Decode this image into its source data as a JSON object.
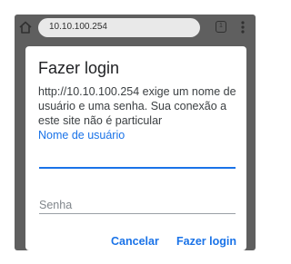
{
  "browser": {
    "url": "10.10.100.254",
    "tab_count": "1",
    "icons": [
      "home-icon",
      "tab-switcher-icon",
      "more-vert-icon"
    ]
  },
  "dialog": {
    "title": "Fazer login",
    "message": "http://10.10.100.254 exige um nome de usuário e uma senha. Sua conexão a este site não é particular",
    "username_label": "Nome de usuário",
    "username_value": "",
    "password_placeholder": "Senha",
    "cancel_label": "Cancelar",
    "login_label": "Fazer login"
  },
  "colors": {
    "accent": "#1a73e8",
    "scrim": "#5f5f5f",
    "omnibox": "#e9e9e9"
  }
}
